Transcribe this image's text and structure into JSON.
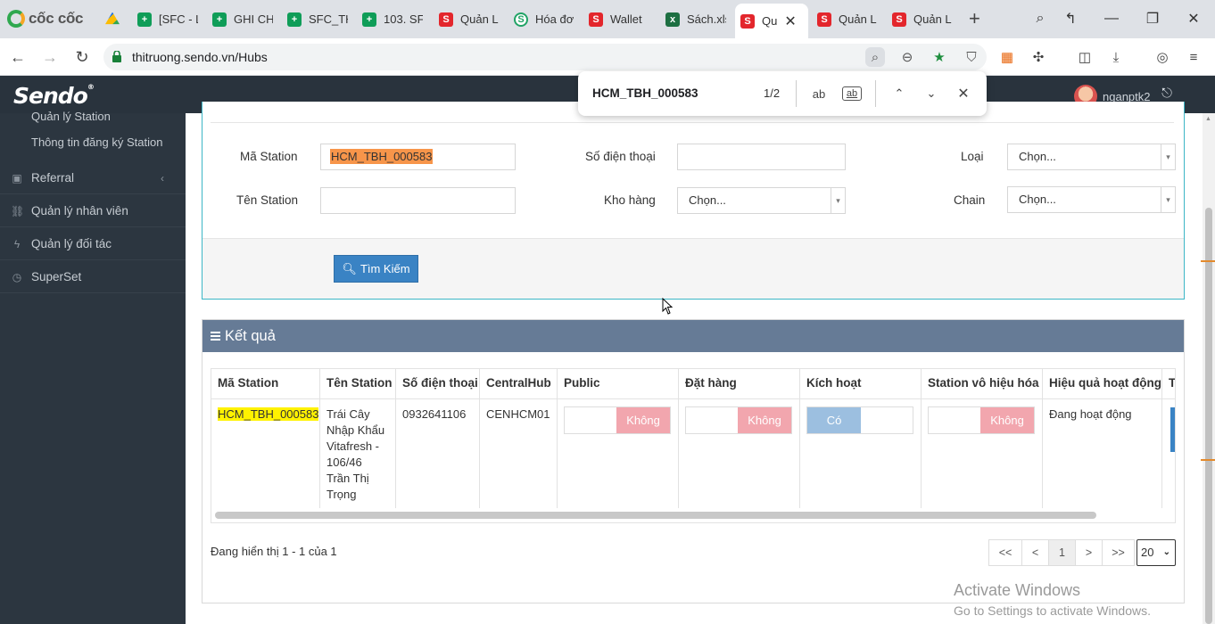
{
  "browser": {
    "brand": "cốc cốc",
    "tabs": [
      {
        "label": "",
        "icon": "drive-icon"
      },
      {
        "label": "[SFC - L",
        "icon": "sheets-icon"
      },
      {
        "label": "GHI CH",
        "icon": "sheets-icon"
      },
      {
        "label": "SFC_TH",
        "icon": "sheets-icon"
      },
      {
        "label": "103. SF",
        "icon": "sheets-icon"
      },
      {
        "label": "Quản L",
        "icon": "sendo-icon"
      },
      {
        "label": "Hóa đơ",
        "icon": "hoadon-icon"
      },
      {
        "label": "Wallet",
        "icon": "sendo-icon"
      },
      {
        "label": "Sách.xls",
        "icon": "excel-icon"
      },
      {
        "label": "Qu",
        "icon": "sendo-icon",
        "active": true
      },
      {
        "label": "Quản L",
        "icon": "sendo-icon"
      },
      {
        "label": "Quản L",
        "icon": "sendo-icon"
      }
    ],
    "url": "thitruong.sendo.vn/Hubs"
  },
  "find_bar": {
    "query": "HCM_TBH_000583",
    "count": "1/2",
    "match_case_label": "ab",
    "whole_word_label": "ab"
  },
  "header": {
    "logo": "Sendo",
    "logo_mark": "®",
    "user_name": "nganptk2"
  },
  "sidebar": {
    "sub_items": [
      "Quản lý Station",
      "Thông tin đăng ký Station"
    ],
    "items": [
      {
        "label": "Referral",
        "icon": "gift-icon",
        "has_chevron": true
      },
      {
        "label": "Quản lý nhân viên",
        "icon": "link-icon"
      },
      {
        "label": "Quản lý đối tác",
        "icon": "bolt-icon"
      },
      {
        "label": "SuperSet",
        "icon": "clock-icon"
      }
    ]
  },
  "search_form": {
    "station_code_label": "Mã Station",
    "station_code_value": "HCM_TBH_000583",
    "phone_label": "Số điện thoại",
    "phone_value": "",
    "type_label": "Loại",
    "type_value": "Chọn...",
    "station_name_label": "Tên Station",
    "station_name_value": "",
    "warehouse_label": "Kho hàng",
    "warehouse_value": "Chọn...",
    "chain_label": "Chain",
    "chain_value": "Chọn...",
    "search_button": "Tìm Kiếm"
  },
  "results": {
    "title": "Kết quả",
    "columns": [
      "Mã Station",
      "Tên Station",
      "Số điện thoại",
      "CentralHub",
      "Public",
      "Đặt hàng",
      "Kích hoạt",
      "Station vô hiệu hóa",
      "Hiệu quả hoạt động",
      "T"
    ],
    "rows": [
      {
        "code": "HCM_TBH_000583",
        "name_lines": [
          "Trái Cây",
          "Nhập Khẩu",
          "Vitafresh -",
          "106/46",
          "Trần Thị",
          "Trọng"
        ],
        "phone": "0932641106",
        "central_hub": "CENHCM01",
        "public": "Không",
        "order": "Không",
        "active": "Có",
        "disabled": "Không",
        "performance": "Đang hoạt động"
      }
    ],
    "paging_text": "Đang hiển thị 1 - 1 của 1",
    "pager": [
      "<<",
      "<",
      "1",
      ">",
      ">>"
    ],
    "page_size": "20"
  },
  "watermark": {
    "line1": "Activate Windows",
    "line2": "Go to Settings to activate Windows."
  },
  "colors": {
    "header_bg": "#29333d",
    "sidebar_bg": "#2c3640",
    "result_header_bg": "#667b96",
    "button_blue": "#3a83c4",
    "find_highlight_current": "#f7954a",
    "find_highlight_other": "#fff200"
  }
}
